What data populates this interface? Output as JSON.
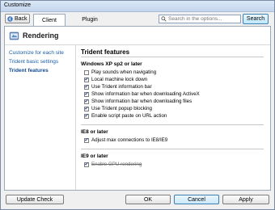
{
  "window": {
    "title": "Customize"
  },
  "toolbar": {
    "back_label": "Back",
    "tabs": [
      {
        "label": "Client"
      },
      {
        "label": "Plugin"
      }
    ],
    "search_placeholder": "Search in the options...",
    "search_button": "Search"
  },
  "header": {
    "title": "Rendering"
  },
  "sidebar": {
    "items": [
      {
        "label": "Customize for each site"
      },
      {
        "label": "Trident basic settings"
      },
      {
        "label": "Trident features"
      }
    ]
  },
  "panel": {
    "title": "Trident features",
    "sections": [
      {
        "title": "Windows XP sp2 or later",
        "options": [
          {
            "label": "Play sounds when navigating",
            "checked": false
          },
          {
            "label": "Local machine lock down",
            "checked": true
          },
          {
            "label": "Use Trident information bar",
            "checked": true
          },
          {
            "label": "Show information bar when downloading ActiveX",
            "checked": true
          },
          {
            "label": "Show information bar when downloading files",
            "checked": true
          },
          {
            "label": "Use Trident popup blocking",
            "checked": true
          },
          {
            "label": "Enable script paste on URL action",
            "checked": true
          }
        ]
      },
      {
        "title": "IE8 or later",
        "options": [
          {
            "label": "Adjust max connections to IE8/IE9",
            "checked": true
          }
        ]
      },
      {
        "title": "IE9 or later",
        "options": [
          {
            "label": "Enable GPU rendering",
            "checked": true
          }
        ]
      }
    ]
  },
  "footer": {
    "update_check": "Update Check",
    "ok": "OK",
    "cancel": "Cancel",
    "apply": "Apply"
  }
}
